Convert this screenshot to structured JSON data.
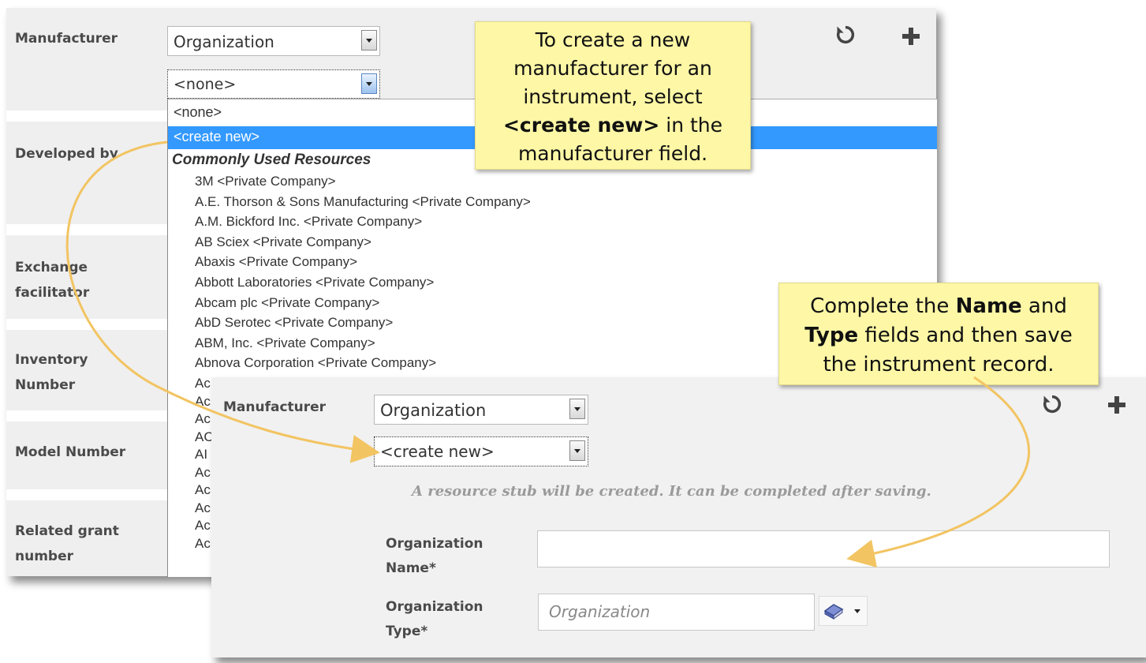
{
  "form": {
    "manufacturer_label": "Manufacturer",
    "developed_by_label": "Developed by",
    "exchange_label_1": "Exchange",
    "exchange_label_2": "facilitator",
    "inventory_label_1": "Inventory",
    "inventory_label_2": "Number",
    "model_label": "Model Number",
    "grant_label_1": "Related grant",
    "grant_label_2": "number",
    "type_select_value": "Organization",
    "resource_select_value": "<none>"
  },
  "dropdown": {
    "none_option": "<none>",
    "create_option": "<create new>",
    "group_header": "Commonly Used Resources",
    "items": [
      "3M <Private Company>",
      "A.E. Thorson & Sons Manufacturing <Private Company>",
      "A.M. Bickford Inc. <Private Company>",
      "AB Sciex <Private Company>",
      "Abaxis <Private Company>",
      "Abbott Laboratories <Private Company>",
      "Abcam plc <Private Company>",
      "AbD Serotec <Private Company>",
      "ABM, Inc. <Private Company>",
      "Abnova Corporation <Private Company>"
    ],
    "truncated": [
      "Ac",
      "Ac",
      "Ac",
      "AC",
      "AI",
      "Ac",
      "Ac",
      "Ac",
      "Ac",
      "Ac"
    ]
  },
  "callout_top": {
    "line1": "To create a new",
    "line2": "manufacturer for an",
    "line3": "instrument, select",
    "line4_bold": "<create new>",
    "line4_rest": " in the",
    "line5": "manufacturer field."
  },
  "callout_mid": {
    "l1_a": "Complete the ",
    "l1_b": "Name",
    "l1_c": " and",
    "l2_a": "Type",
    "l2_b": " fields and then save",
    "l3": "the instrument record."
  },
  "panel2": {
    "manufacturer_label": "Manufacturer",
    "type_select_value": "Organization",
    "resource_select_value": "<create new>",
    "stub_note": "A resource stub will be created. It can be completed after saving.",
    "org_name_label_1": "Organization",
    "org_name_label_2": "Name*",
    "org_type_label_1": "Organization",
    "org_type_label_2": "Type*",
    "org_type_placeholder": "Organization"
  },
  "icons": {
    "reset": "reset-icon",
    "add": "plus-icon",
    "book": "book-icon"
  },
  "colors": {
    "highlight": "#3399ff",
    "callout_bg": "#fdf7a6",
    "arrow": "#f2c462"
  }
}
